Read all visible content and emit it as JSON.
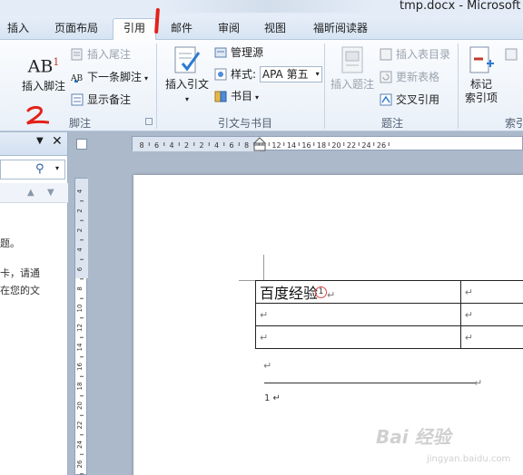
{
  "window": {
    "title": "tmp.docx - Microsoft W"
  },
  "tabs": [
    {
      "label": "插入",
      "active": false
    },
    {
      "label": "页面布局",
      "active": false
    },
    {
      "label": "引用",
      "active": true
    },
    {
      "label": "邮件",
      "active": false
    },
    {
      "label": "审阅",
      "active": false
    },
    {
      "label": "视图",
      "active": false
    },
    {
      "label": "福昕阅读器",
      "active": false
    }
  ],
  "ribbon": {
    "footnotes": {
      "label": "脚注",
      "insert_footnote": "插入脚注",
      "ab_icon_text": "AB",
      "ab_icon_sup": "1",
      "insert_endnote": "插入尾注",
      "next_footnote": "下一条脚注",
      "show_notes": "显示备注"
    },
    "citations": {
      "label": "引文与书目",
      "insert_citation": "插入引文",
      "manage_sources": "管理源",
      "style_label": "样式:",
      "style_value": "APA 第五",
      "bibliography": "书目"
    },
    "captions": {
      "label": "题注",
      "insert_caption": "插入题注",
      "insert_table_of_figures": "插入表目录",
      "update_table": "更新表格",
      "cross_reference": "交叉引用"
    },
    "index": {
      "label": "索引",
      "mark_entry_line1": "标记",
      "mark_entry_line2": "索引项"
    }
  },
  "annotations": {
    "mark1": "1",
    "mark2": "2"
  },
  "navpane": {
    "text_lines": [
      "题。",
      "卡，请通",
      "在您的文"
    ]
  },
  "document": {
    "table": [
      [
        "百度经验",
        "↵"
      ],
      [
        "↵",
        "↵"
      ],
      [
        "↵",
        "↵"
      ]
    ],
    "footnote_ref": "1",
    "para_mark": "↵",
    "footnote_text": "1 ↵"
  },
  "vertical_ruler_labels": [
    "4",
    "2",
    "2",
    "4",
    "6",
    "8",
    "10",
    "12",
    "14",
    "16",
    "18",
    "20",
    "22",
    "24",
    "26"
  ],
  "horizontal_ruler_labels": [
    "8",
    "6",
    "4",
    "2",
    "2",
    "4",
    "6",
    "8",
    "10",
    "12",
    "14",
    "16",
    "18",
    "20",
    "22",
    "24",
    "26"
  ],
  "watermark": {
    "text": "Bai 经验",
    "sub": "jingyan.baidu.com"
  },
  "colors": {
    "annotation_red": "#e2231a",
    "ribbon_blue": "#dbe6f4"
  }
}
